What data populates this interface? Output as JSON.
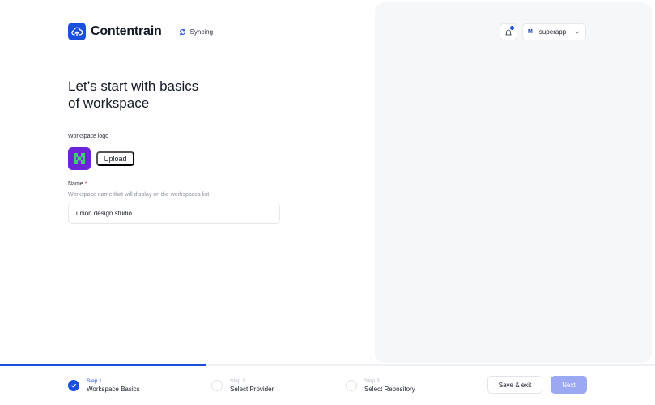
{
  "header": {
    "brand": "Contentrain",
    "sync_status": "Syncing"
  },
  "main": {
    "heading_line1": "Let’s start with basics",
    "heading_line2": "of workspace",
    "logo_label": "Workspace logo",
    "upload_label": "Upload",
    "name_label": "Name",
    "name_required_mark": "*",
    "name_hint": "Workspace name that will display on the workspaces list",
    "name_value": "union design studio"
  },
  "account": {
    "badge": "M",
    "name": "superapp"
  },
  "footer": {
    "progress": 0.314,
    "steps": [
      {
        "number": "Step 1",
        "title": "Workspace Basics",
        "state": "completed"
      },
      {
        "number": "Step 2",
        "title": "Select Provider",
        "state": "pending"
      },
      {
        "number": "Step 3",
        "title": "Select Repository",
        "state": "pending"
      }
    ],
    "save_exit_label": "Save & exit",
    "next_label": "Next"
  },
  "icons": {
    "brand": "cloud-upload-icon",
    "sync": "refresh-icon",
    "notification": "bell-icon",
    "dropdown": "chevron-down-icon",
    "step_done": "check-icon"
  },
  "colors": {
    "accent": "#1b4fe0",
    "workspace_logo_bg": "#6d24d9",
    "workspace_logo_fg": "#3ccf6e",
    "next_disabled": "#9aa9f2",
    "panel_bg": "#f6f7f9"
  }
}
